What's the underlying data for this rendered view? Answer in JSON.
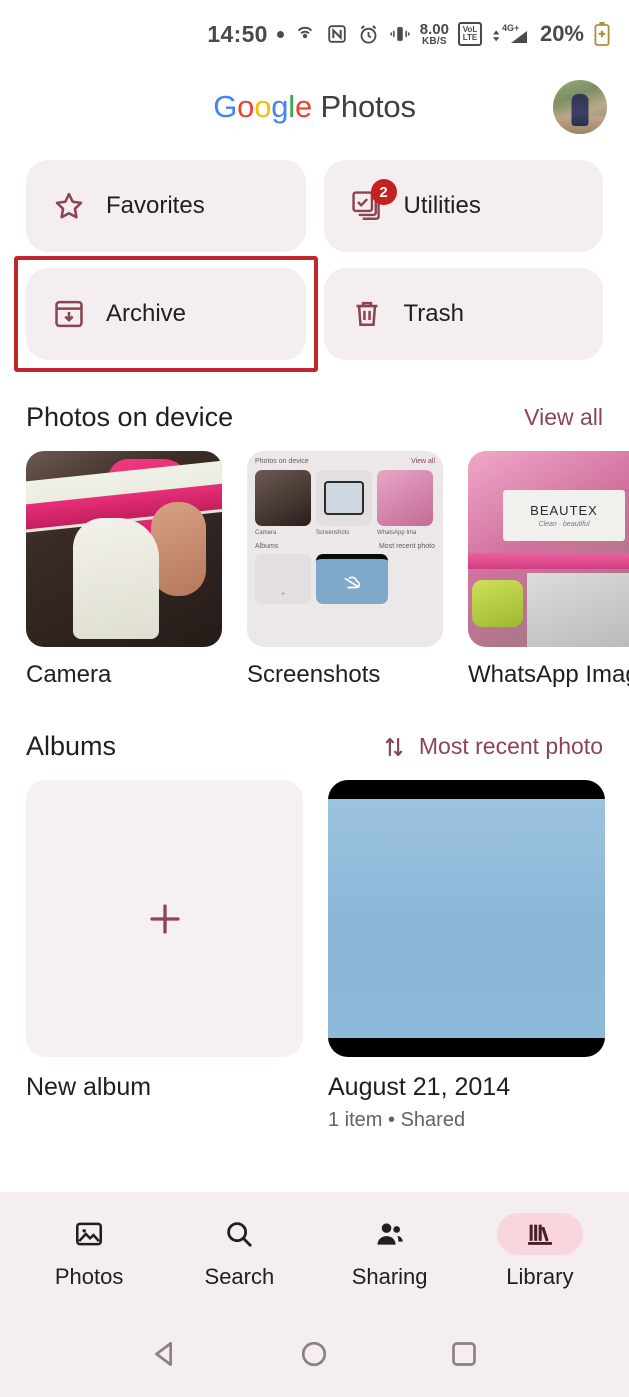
{
  "status_bar": {
    "time": "14:50",
    "dot": "•",
    "icons": [
      "hotspot-icon",
      "nfc-icon",
      "alarm-icon",
      "vibrate-icon"
    ],
    "data_rate_value": "8.00",
    "data_rate_unit": "KB/S",
    "volte_top": "VoL",
    "volte_bottom": "LTE",
    "network": "4G+",
    "battery_percent": "20%"
  },
  "header": {
    "brand_google": "Google",
    "brand_word": "Photos",
    "avatar_name": "account-avatar"
  },
  "quick_actions": [
    {
      "label": "Favorites",
      "icon": "star-icon",
      "badge": null,
      "highlighted": false
    },
    {
      "label": "Utilities",
      "icon": "utilities-icon",
      "badge": "2",
      "highlighted": false
    },
    {
      "label": "Archive",
      "icon": "archive-icon",
      "badge": null,
      "highlighted": true
    },
    {
      "label": "Trash",
      "icon": "trash-icon",
      "badge": null,
      "highlighted": false
    }
  ],
  "photos_on_device": {
    "title": "Photos on device",
    "action": "View all",
    "folders": [
      {
        "name": "Camera"
      },
      {
        "name": "Screenshots"
      },
      {
        "name": "WhatsApp Images"
      }
    ]
  },
  "screenshot_thumb": {
    "title": "Photos on device",
    "view_all": "View all",
    "captions": [
      "Camera",
      "Screenshots",
      "WhatsApp Ima"
    ],
    "albums_label": "Albums",
    "sort_label": "Most recent photo",
    "plus": "+"
  },
  "whatsapp_thumb": {
    "brand": "BEAUTEX",
    "script": "Clean · beautiful"
  },
  "albums": {
    "title": "Albums",
    "sort_label": "Most recent photo",
    "sort_icon": "sort-arrows-icon",
    "items": [
      {
        "title": "New album",
        "subtitle": "",
        "icon": "plus-icon",
        "kind": "new"
      },
      {
        "title": "August 21, 2014",
        "subtitle": "1 item  •  Shared",
        "kind": "photo"
      }
    ]
  },
  "bottom_nav": {
    "items": [
      {
        "label": "Photos",
        "icon": "photo-icon",
        "active": false
      },
      {
        "label": "Search",
        "icon": "search-icon",
        "active": false
      },
      {
        "label": "Sharing",
        "icon": "people-icon",
        "active": false
      },
      {
        "label": "Library",
        "icon": "library-icon",
        "active": true
      }
    ]
  },
  "system_nav": {
    "back": "back-triangle-icon",
    "home": "home-circle-icon",
    "recents": "recents-square-icon"
  },
  "colors": {
    "accent": "#8b4552",
    "card_bg": "#f4eef0",
    "badge_red": "#c5221f",
    "highlight_red": "#c0272d",
    "active_pill": "#f9d6de"
  }
}
